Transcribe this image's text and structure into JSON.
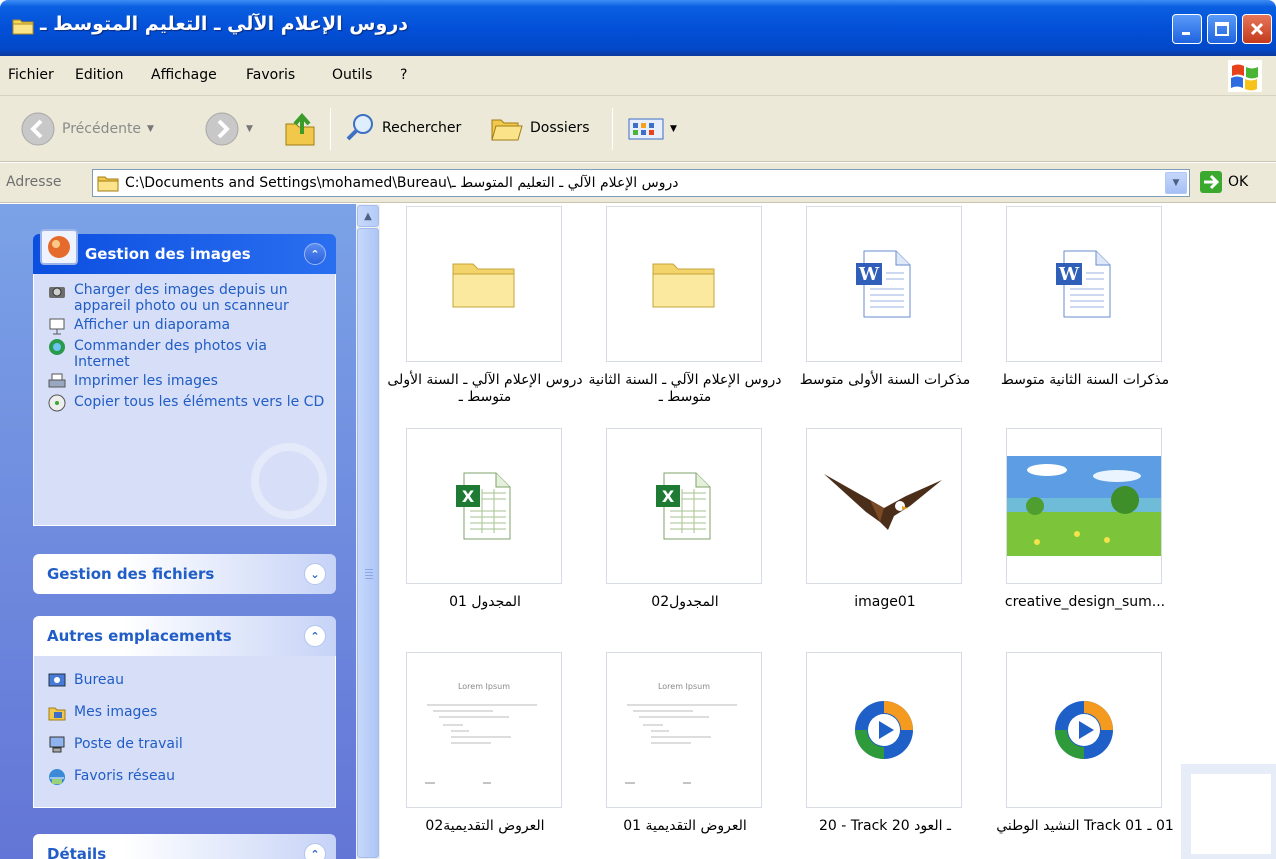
{
  "window": {
    "title": "دروس الإعلام الآلي ـ التعليم المتوسط ـ",
    "buttons": {
      "minimize": "minimize",
      "maximize": "maximize",
      "close": "close"
    }
  },
  "menu": [
    "Fichier",
    "Edition",
    "Affichage",
    "Favoris",
    "Outils",
    "?"
  ],
  "toolbar": {
    "back": "Précédente",
    "search": "Rechercher",
    "folders": "Dossiers"
  },
  "address": {
    "label": "Adresse",
    "path": "C:\\Documents and Settings\\mohamed\\Bureau\\دروس الإعلام الآلي ـ التعليم المتوسط ـ",
    "go": "OK"
  },
  "panels": {
    "images": {
      "title": "Gestion des images",
      "tasks": [
        "Charger des images depuis un appareil photo ou un scanneur",
        "Afficher un diaporama",
        "Commander des photos via Internet",
        "Imprimer les images",
        "Copier tous les éléments vers le CD"
      ]
    },
    "files": {
      "title": "Gestion des fichiers"
    },
    "places": {
      "title": "Autres emplacements",
      "links": [
        "Bureau",
        "Mes images",
        "Poste de travail",
        "Favoris réseau"
      ]
    },
    "details": {
      "title": "Détails"
    }
  },
  "files": [
    {
      "name": "دروس الإعلام الآلي ـ السنة الأولى متوسط ـ",
      "type": "folder"
    },
    {
      "name": "دروس الإعلام الآلي ـ السنة الثانية متوسط ـ",
      "type": "folder"
    },
    {
      "name": "مذكرات السنة الأولى متوسط",
      "type": "word"
    },
    {
      "name": "مذكرات السنة الثانية متوسط",
      "type": "word"
    },
    {
      "name": "المجدول 01",
      "type": "excel"
    },
    {
      "name": "المجدول02",
      "type": "excel"
    },
    {
      "name": "image01",
      "type": "eagle"
    },
    {
      "name": "creative_design_sum...",
      "type": "landscape"
    },
    {
      "name": "العروض التقديمية02",
      "type": "doc-preview"
    },
    {
      "name": "العروض التقديمية 01",
      "type": "doc-preview"
    },
    {
      "name": "20 - Track 20 ـ العود",
      "type": "media"
    },
    {
      "name": "01 ـ Track 01 النشيد الوطني",
      "type": "media"
    }
  ],
  "preview_text": {
    "heading": "Lorem Ipsum"
  },
  "colors": {
    "titlebar": "#0350d8",
    "taskpane": "#6f8ee0",
    "link": "#215dc6",
    "chrome": "#ece9d8"
  }
}
